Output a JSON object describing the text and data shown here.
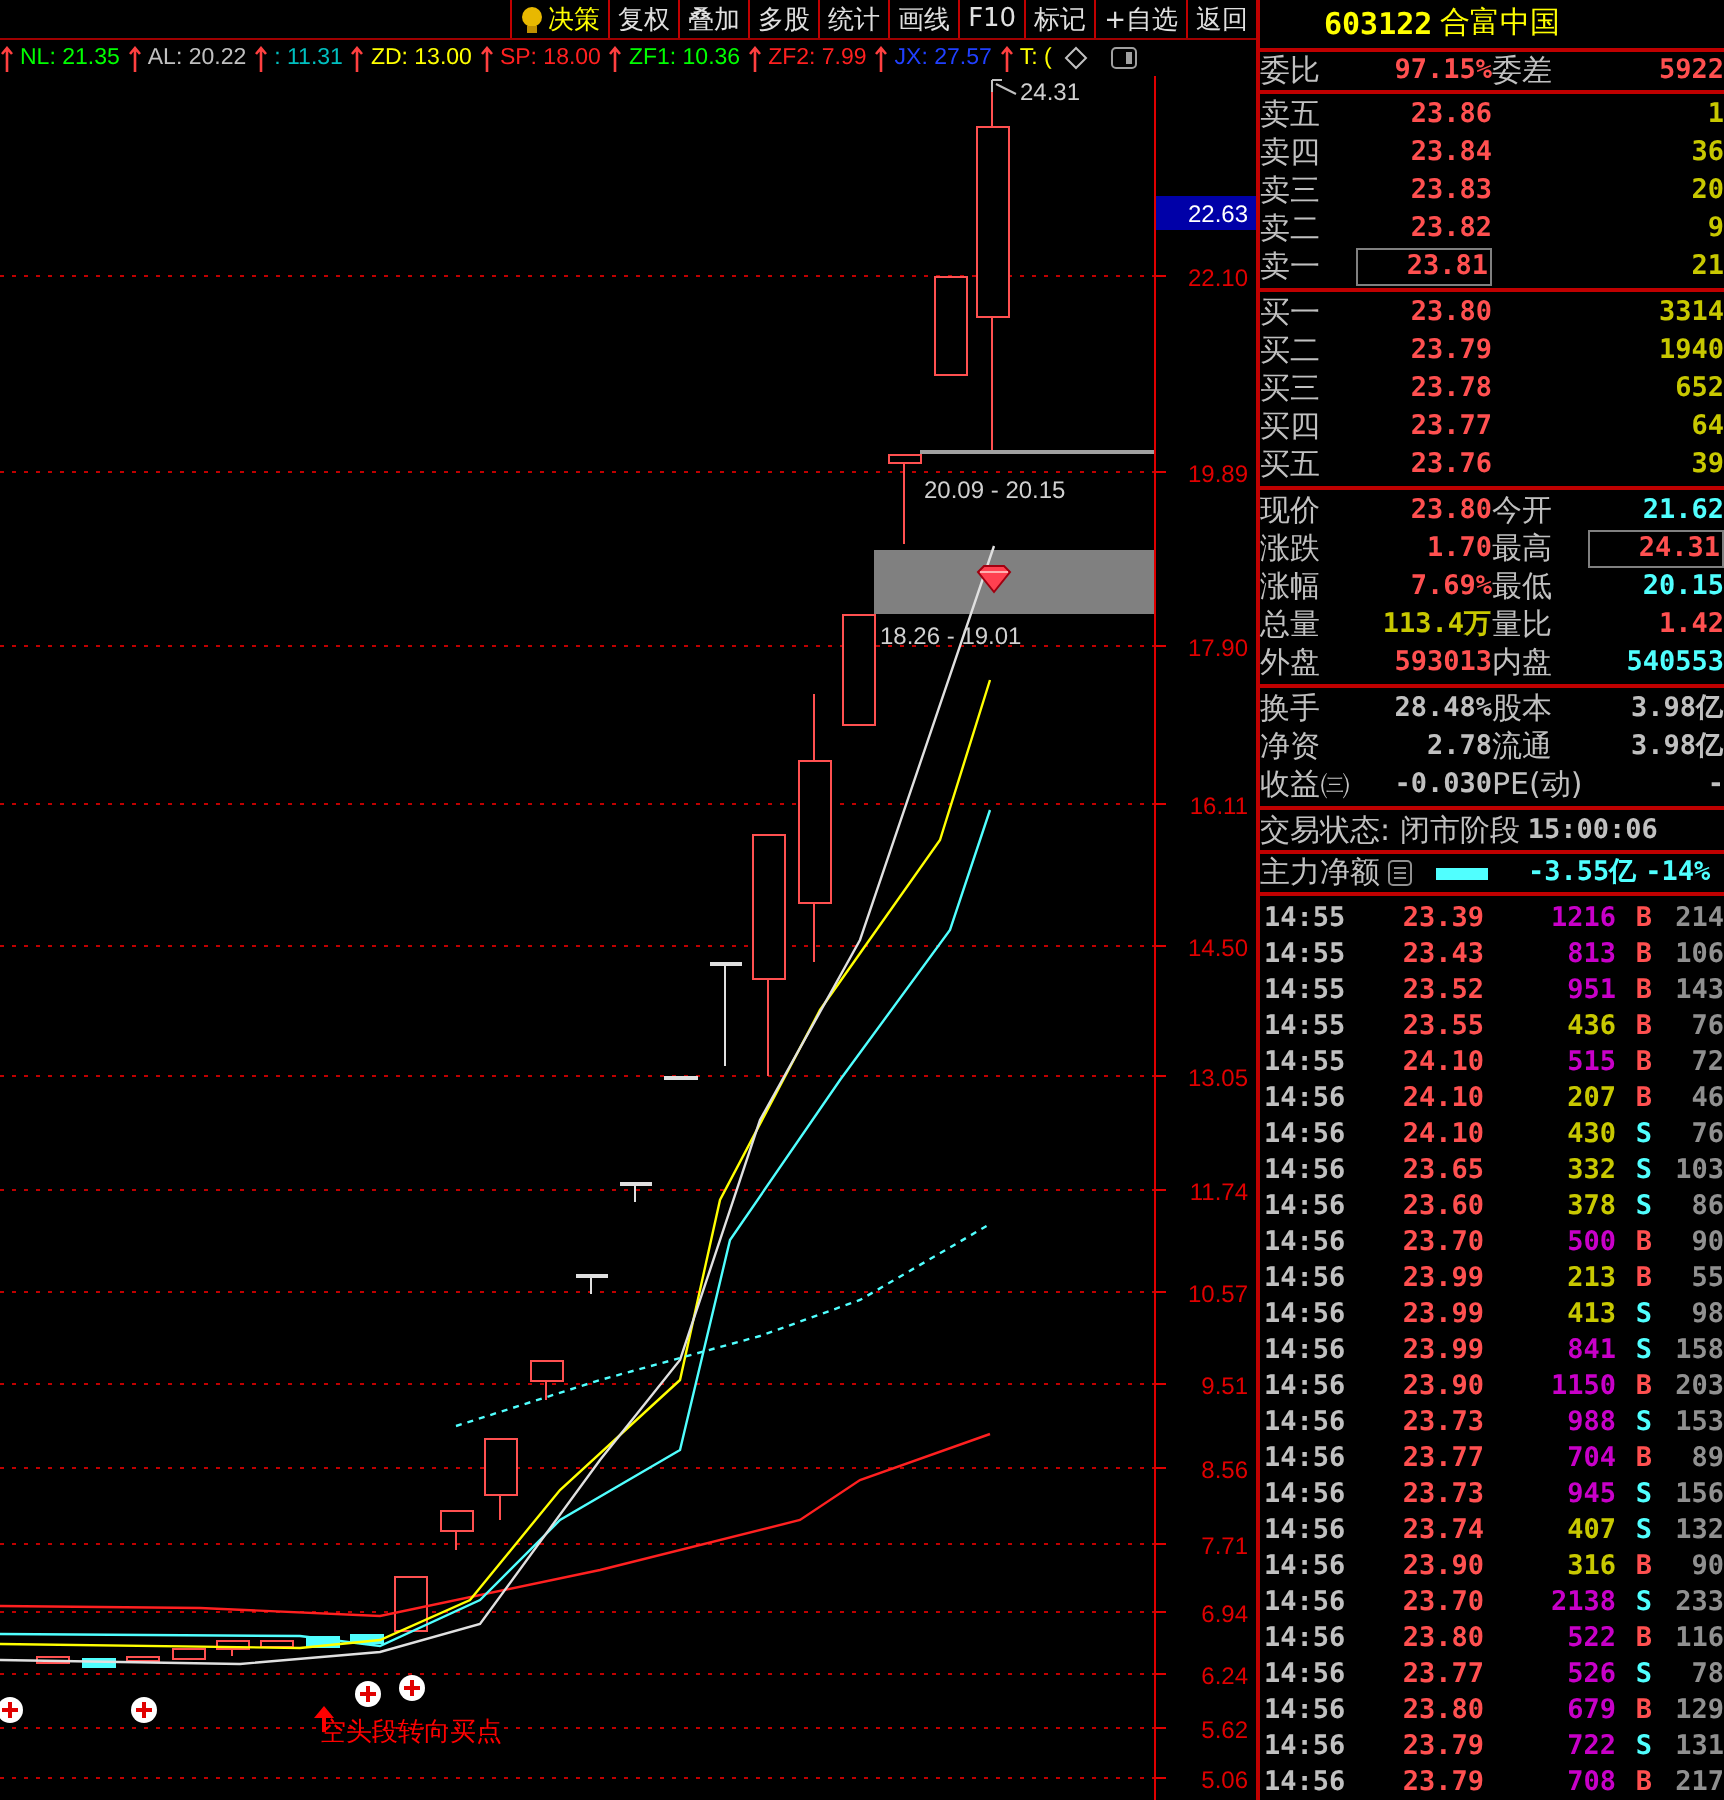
{
  "toolbar": {
    "buttons": [
      {
        "label": "决策",
        "kind": "decision"
      },
      {
        "label": "复权",
        "kind": "plain"
      },
      {
        "label": "叠加",
        "kind": "plain"
      },
      {
        "label": "多股",
        "kind": "plain"
      },
      {
        "label": "统计",
        "kind": "plain"
      },
      {
        "label": "画线",
        "kind": "plain"
      },
      {
        "label": "F10",
        "kind": "plain"
      },
      {
        "label": "标记",
        "kind": "plain"
      },
      {
        "label": "+自选",
        "kind": "plain"
      },
      {
        "label": "返回",
        "kind": "plain"
      }
    ]
  },
  "indicators": [
    {
      "label": "NL: 21.35",
      "color": "#00ff00"
    },
    {
      "label": "AL: 20.22",
      "color": "#c0c0c0"
    },
    {
      "label": ": 11.31",
      "color": "#00c0c0"
    },
    {
      "label": "ZD: 13.00",
      "color": "#ffff00"
    },
    {
      "label": "SP: 18.00",
      "color": "#ff2020"
    },
    {
      "label": "ZF1: 10.36",
      "color": "#00ff00"
    },
    {
      "label": "ZF2: 7.99",
      "color": "#ff2020"
    },
    {
      "label": "JX: 27.57",
      "color": "#2040ff"
    },
    {
      "label": "T: (",
      "color": "#ffff00"
    }
  ],
  "chart": {
    "price_labels": [
      "22.10",
      "19.89",
      "17.90",
      "16.11",
      "14.50",
      "13.05",
      "11.74",
      "10.57",
      "9.51",
      "8.56",
      "7.71",
      "6.94",
      "6.24",
      "5.62",
      "5.06"
    ],
    "current_price": "22.63",
    "high_label": "24.31",
    "range_labels": [
      "20.09 - 20.15",
      "18.26 - 19.01"
    ],
    "signal_label": "空头段转向买点"
  },
  "quote": {
    "code": "603122",
    "name": "合富中国",
    "ratio": [
      {
        "label": "委比",
        "value": "97.15%"
      },
      {
        "label": "委差",
        "value": "5922"
      }
    ],
    "sells": [
      {
        "label": "卖五",
        "price": "23.86",
        "volume": "1",
        "boxed": false
      },
      {
        "label": "卖四",
        "price": "23.84",
        "volume": "36",
        "boxed": false
      },
      {
        "label": "卖三",
        "price": "23.83",
        "volume": "20",
        "boxed": false
      },
      {
        "label": "卖二",
        "price": "23.82",
        "volume": "9",
        "boxed": false
      },
      {
        "label": "卖一",
        "price": "23.81",
        "volume": "21",
        "boxed": true
      }
    ],
    "buys": [
      {
        "label": "买一",
        "price": "23.80",
        "volume": "3314",
        "boxed": false
      },
      {
        "label": "买二",
        "price": "23.79",
        "volume": "1940",
        "boxed": false
      },
      {
        "label": "买三",
        "price": "23.78",
        "volume": "652",
        "boxed": false
      },
      {
        "label": "买四",
        "price": "23.77",
        "volume": "64",
        "boxed": false
      },
      {
        "label": "买五",
        "price": "23.76",
        "volume": "39",
        "boxed": false
      }
    ],
    "stats": [
      [
        {
          "label": "现价",
          "value": "23.80",
          "color": "#ff5050",
          "boxed": false
        },
        {
          "label": "今开",
          "value": "21.62",
          "color": "#50ffff",
          "boxed": false
        }
      ],
      [
        {
          "label": "涨跌",
          "value": "1.70",
          "color": "#ff5050",
          "boxed": false
        },
        {
          "label": "最高",
          "value": "24.31",
          "color": "#ff5050",
          "boxed": true
        }
      ],
      [
        {
          "label": "涨幅",
          "value": "7.69%",
          "color": "#ff5050",
          "boxed": false
        },
        {
          "label": "最低",
          "value": "20.15",
          "color": "#50ffff",
          "boxed": false
        }
      ],
      [
        {
          "label": "总量",
          "value": "113.4万",
          "color": "#c8c800",
          "boxed": false
        },
        {
          "label": "量比",
          "value": "1.42",
          "color": "#ff5050",
          "boxed": false
        }
      ],
      [
        {
          "label": "外盘",
          "value": "593013",
          "color": "#ff5050",
          "boxed": false
        },
        {
          "label": "内盘",
          "value": "540553",
          "color": "#50ffff",
          "boxed": false
        }
      ]
    ],
    "finance": [
      [
        {
          "label": "换手",
          "value": "28.48%"
        },
        {
          "label": "股本",
          "value": "3.98亿"
        }
      ],
      [
        {
          "label": "净资",
          "value": "2.78"
        },
        {
          "label": "流通",
          "value": "3.98亿"
        }
      ],
      [
        {
          "label": "收益㈢",
          "value": "-0.030"
        },
        {
          "label": "PE(动)",
          "value": "-"
        }
      ]
    ],
    "status": {
      "label": "交易状态: 闭市阶段",
      "time": "15:00:06"
    },
    "main_force": {
      "label": "主力净额",
      "amount": "-3.55亿",
      "percent": "-14%"
    }
  },
  "trades": [
    {
      "time": "14:55",
      "price": "23.39",
      "volume": "1216",
      "color": "#c800c8",
      "side": "B",
      "buy": true,
      "count": "214"
    },
    {
      "time": "14:55",
      "price": "23.43",
      "volume": "813",
      "color": "#c800c8",
      "side": "B",
      "buy": true,
      "count": "106"
    },
    {
      "time": "14:55",
      "price": "23.52",
      "volume": "951",
      "color": "#c800c8",
      "side": "B",
      "buy": true,
      "count": "143"
    },
    {
      "time": "14:55",
      "price": "23.55",
      "volume": "436",
      "color": "#c8c800",
      "side": "B",
      "buy": true,
      "count": "76"
    },
    {
      "time": "14:55",
      "price": "24.10",
      "volume": "515",
      "color": "#c800c8",
      "side": "B",
      "buy": true,
      "count": "72"
    },
    {
      "time": "14:56",
      "price": "24.10",
      "volume": "207",
      "color": "#c8c800",
      "side": "B",
      "buy": true,
      "count": "46"
    },
    {
      "time": "14:56",
      "price": "24.10",
      "volume": "430",
      "color": "#c8c800",
      "side": "S",
      "buy": false,
      "count": "76"
    },
    {
      "time": "14:56",
      "price": "23.65",
      "volume": "332",
      "color": "#c8c800",
      "side": "S",
      "buy": false,
      "count": "103"
    },
    {
      "time": "14:56",
      "price": "23.60",
      "volume": "378",
      "color": "#c8c800",
      "side": "S",
      "buy": false,
      "count": "86"
    },
    {
      "time": "14:56",
      "price": "23.70",
      "volume": "500",
      "color": "#c800c8",
      "side": "B",
      "buy": true,
      "count": "90"
    },
    {
      "time": "14:56",
      "price": "23.99",
      "volume": "213",
      "color": "#c8c800",
      "side": "B",
      "buy": true,
      "count": "55"
    },
    {
      "time": "14:56",
      "price": "23.99",
      "volume": "413",
      "color": "#c8c800",
      "side": "S",
      "buy": false,
      "count": "98"
    },
    {
      "time": "14:56",
      "price": "23.99",
      "volume": "841",
      "color": "#c800c8",
      "side": "S",
      "buy": false,
      "count": "158"
    },
    {
      "time": "14:56",
      "price": "23.90",
      "volume": "1150",
      "color": "#c800c8",
      "side": "B",
      "buy": true,
      "count": "203"
    },
    {
      "time": "14:56",
      "price": "23.73",
      "volume": "988",
      "color": "#c800c8",
      "side": "S",
      "buy": false,
      "count": "153"
    },
    {
      "time": "14:56",
      "price": "23.77",
      "volume": "704",
      "color": "#c800c8",
      "side": "B",
      "buy": true,
      "count": "89"
    },
    {
      "time": "14:56",
      "price": "23.73",
      "volume": "945",
      "color": "#c800c8",
      "side": "S",
      "buy": false,
      "count": "156"
    },
    {
      "time": "14:56",
      "price": "23.74",
      "volume": "407",
      "color": "#c8c800",
      "side": "S",
      "buy": false,
      "count": "132"
    },
    {
      "time": "14:56",
      "price": "23.90",
      "volume": "316",
      "color": "#c8c800",
      "side": "B",
      "buy": true,
      "count": "90"
    },
    {
      "time": "14:56",
      "price": "23.70",
      "volume": "2138",
      "color": "#c800c8",
      "side": "S",
      "buy": false,
      "count": "233"
    },
    {
      "time": "14:56",
      "price": "23.80",
      "volume": "522",
      "color": "#c800c8",
      "side": "B",
      "buy": true,
      "count": "116"
    },
    {
      "time": "14:56",
      "price": "23.77",
      "volume": "526",
      "color": "#c800c8",
      "side": "S",
      "buy": false,
      "count": "78"
    },
    {
      "time": "14:56",
      "price": "23.80",
      "volume": "679",
      "color": "#c800c8",
      "side": "B",
      "buy": true,
      "count": "129"
    },
    {
      "time": "14:56",
      "price": "23.79",
      "volume": "722",
      "color": "#c800c8",
      "side": "S",
      "buy": false,
      "count": "131"
    },
    {
      "time": "14:56",
      "price": "23.79",
      "volume": "708",
      "color": "#c800c8",
      "side": "B",
      "buy": true,
      "count": "217"
    }
  ]
}
